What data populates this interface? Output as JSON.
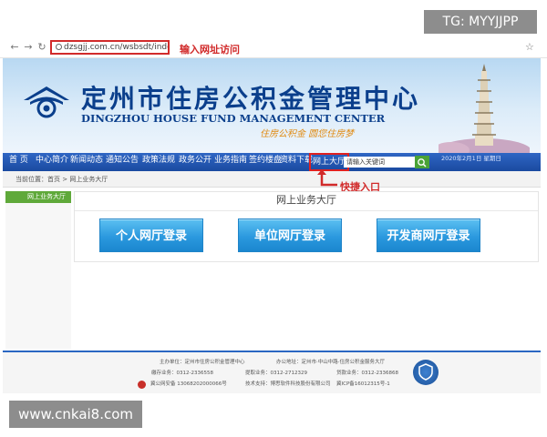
{
  "watermarks": {
    "top": "TG: MYYJJPP",
    "bottom": "www.cnkai8.com"
  },
  "browser": {
    "url": "dzsgjj.com.cn/wsbsdt/index.jhtml",
    "url_annotation": "输入网址访问",
    "back_icon": "arrow-left-icon",
    "forward_icon": "arrow-right-icon",
    "reload_icon": "reload-icon",
    "bookmark_icon": "star-icon"
  },
  "header": {
    "title_cn": "定州市住房公积金管理中心",
    "title_en": "DINGZHOU HOUSE FUND MANAGEMENT CENTER",
    "slogan": "住房公积金   圆您住房梦",
    "brand_color": "#0b3f8c"
  },
  "nav": {
    "items": [
      "首 页",
      "中心简介",
      "新闻动态",
      "通知公告",
      "政策法规",
      "政务公开",
      "业务指南",
      "签约楼盘",
      "资料下载",
      "网上大厅"
    ],
    "active_index": 9,
    "search_placeholder": "请输入关键词",
    "search_icon": "search-icon",
    "date": "2020年2月1日  星期日"
  },
  "annotations": {
    "quick_entry": "快捷入口"
  },
  "breadcrumb": {
    "prefix": "当前位置：",
    "home": "首页",
    "sep": " > ",
    "current": "网上业务大厅"
  },
  "sidebar": {
    "title": "网上业务大厅"
  },
  "panel": {
    "title": "网上业务大厅",
    "buttons": [
      "个人网厅登录",
      "单位网厅登录",
      "开发商网厅登录"
    ]
  },
  "footer": {
    "row1": [
      "主办单位：定州市住房公积金管理中心",
      "办公地址：定州市·中山中路·住房公积金服务大厅"
    ],
    "row2": [
      "缴存业务：0312-2336558",
      "提取业务：0312-2712329",
      "贷款业务：0312-2336868"
    ],
    "row3": [
      "冀公网安备 13068202000066号",
      "技术支持：博思软件科技股份有限公司",
      "冀ICP备16012315号-1"
    ]
  }
}
